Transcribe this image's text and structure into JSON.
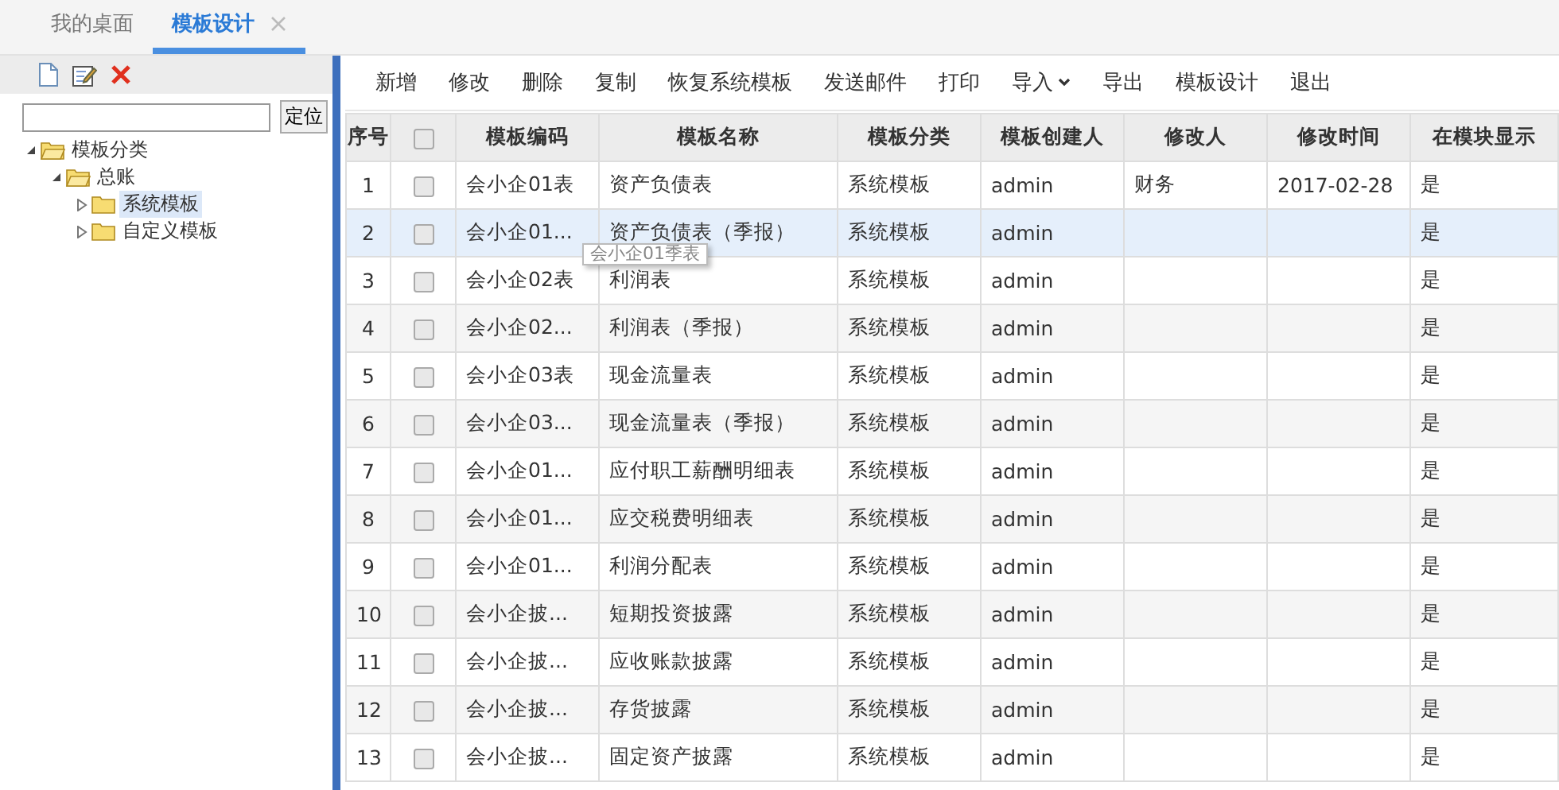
{
  "tabs": [
    {
      "label": "我的桌面",
      "selected": false,
      "closable": false
    },
    {
      "label": "模板设计",
      "selected": true,
      "closable": true
    }
  ],
  "sidebar": {
    "locate_button": "定位",
    "tree": [
      {
        "label": "模板分类",
        "expanded": true,
        "selected": false,
        "children": [
          {
            "label": "总账",
            "expanded": true,
            "selected": false,
            "children": [
              {
                "label": "系统模板",
                "expanded": false,
                "selected": true
              },
              {
                "label": "自定义模板",
                "expanded": false,
                "selected": false
              }
            ]
          }
        ]
      }
    ]
  },
  "toolbar": [
    {
      "label": "新增",
      "dropdown": false
    },
    {
      "label": "修改",
      "dropdown": false
    },
    {
      "label": "删除",
      "dropdown": false
    },
    {
      "label": "复制",
      "dropdown": false
    },
    {
      "label": "恢复系统模板",
      "dropdown": false
    },
    {
      "label": "发送邮件",
      "dropdown": false
    },
    {
      "label": "打印",
      "dropdown": false
    },
    {
      "label": "导入",
      "dropdown": true
    },
    {
      "label": "导出",
      "dropdown": false
    },
    {
      "label": "模板设计",
      "dropdown": false
    },
    {
      "label": "退出",
      "dropdown": false
    }
  ],
  "table": {
    "columns": [
      "序号",
      "模板编码",
      "模板名称",
      "模板分类",
      "模板创建人",
      "修改人",
      "修改时间",
      "在模块显示"
    ],
    "header_checked": false,
    "rows": [
      {
        "selected": false,
        "checked": false,
        "cells": [
          "1",
          "会小企01表",
          "资产负债表",
          "系统模板",
          "admin",
          "财务",
          "2017-02-28",
          "是"
        ]
      },
      {
        "selected": true,
        "checked": false,
        "cells": [
          "2",
          "会小企01...",
          "资产负债表（季报）",
          "系统模板",
          "admin",
          "",
          "",
          "是"
        ]
      },
      {
        "selected": false,
        "checked": false,
        "cells": [
          "3",
          "会小企02表",
          "利润表",
          "系统模板",
          "admin",
          "",
          "",
          "是"
        ]
      },
      {
        "selected": false,
        "checked": false,
        "cells": [
          "4",
          "会小企02...",
          "利润表（季报）",
          "系统模板",
          "admin",
          "",
          "",
          "是"
        ]
      },
      {
        "selected": false,
        "checked": false,
        "cells": [
          "5",
          "会小企03表",
          "现金流量表",
          "系统模板",
          "admin",
          "",
          "",
          "是"
        ]
      },
      {
        "selected": false,
        "checked": false,
        "cells": [
          "6",
          "会小企03...",
          "现金流量表（季报）",
          "系统模板",
          "admin",
          "",
          "",
          "是"
        ]
      },
      {
        "selected": false,
        "checked": false,
        "cells": [
          "7",
          "会小企01...",
          "应付职工薪酬明细表",
          "系统模板",
          "admin",
          "",
          "",
          "是"
        ]
      },
      {
        "selected": false,
        "checked": false,
        "cells": [
          "8",
          "会小企01...",
          "应交税费明细表",
          "系统模板",
          "admin",
          "",
          "",
          "是"
        ]
      },
      {
        "selected": false,
        "checked": false,
        "cells": [
          "9",
          "会小企01...",
          "利润分配表",
          "系统模板",
          "admin",
          "",
          "",
          "是"
        ]
      },
      {
        "selected": false,
        "checked": false,
        "cells": [
          "10",
          "会小企披...",
          "短期投资披露",
          "系统模板",
          "admin",
          "",
          "",
          "是"
        ]
      },
      {
        "selected": false,
        "checked": false,
        "cells": [
          "11",
          "会小企披...",
          "应收账款披露",
          "系统模板",
          "admin",
          "",
          "",
          "是"
        ]
      },
      {
        "selected": false,
        "checked": false,
        "cells": [
          "12",
          "会小企披...",
          "存货披露",
          "系统模板",
          "admin",
          "",
          "",
          "是"
        ]
      },
      {
        "selected": false,
        "checked": false,
        "cells": [
          "13",
          "会小企披...",
          "固定资产披露",
          "系统模板",
          "admin",
          "",
          "",
          "是"
        ]
      }
    ]
  },
  "tooltip": {
    "text": "会小企01季表"
  }
}
